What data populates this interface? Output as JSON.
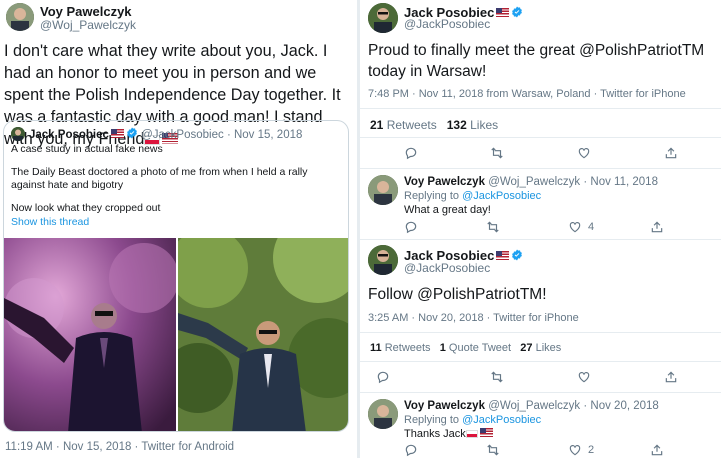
{
  "left": {
    "author": {
      "name": "Voy Pawelczyk",
      "handle": "@Woj_Pawelczyk"
    },
    "text": "I don't care what they write about you, Jack. I had an honor to meet you in person and we spent the Polish Independence Day together. It was a fantastic day with a good man! I stand with you, my Friend",
    "quote": {
      "name": "Jack Posobiec",
      "handle": "@JackPosobiec",
      "date": "· Nov 15, 2018",
      "line1": "A case study in actual fake news",
      "line2": "The Daily Beast doctored a photo of me from when I held a rally against hate and bigotry",
      "line3": "Now look what they cropped out",
      "show_thread": "Show this thread"
    },
    "timestamp": "11:19 AM · Nov 15, 2018 · Twitter for Android"
  },
  "right": {
    "tweet1": {
      "name": "Jack Posobiec",
      "handle": "@JackPosobiec",
      "text": "Proud to finally meet the great @PolishPatriotTM today in Warsaw!",
      "timestamp": "7:48 PM · Nov 11, 2018 from Warsaw, Poland · Twitter for iPhone",
      "retweets_count": "21",
      "retweets_label": "Retweets",
      "likes_count": "132",
      "likes_label": "Likes"
    },
    "reply1": {
      "name": "Voy Pawelczyk",
      "handle": "@Woj_Pawelczyk",
      "date": "· Nov 11, 2018",
      "replying_prefix": "Replying to",
      "replying_to": "@JackPosobiec",
      "text": "What a great day!",
      "likes": "4"
    },
    "tweet2": {
      "name": "Jack Posobiec",
      "handle": "@JackPosobiec",
      "text": "Follow @PolishPatriotTM!",
      "timestamp": "3:25 AM · Nov 20, 2018 · Twitter for iPhone",
      "retweets_count": "11",
      "retweets_label": "Retweets",
      "quotes_count": "1",
      "quotes_label": "Quote Tweet",
      "likes_count": "27",
      "likes_label": "Likes"
    },
    "reply2": {
      "name": "Voy Pawelczyk",
      "handle": "@Woj_Pawelczyk",
      "date": "· Nov 20, 2018",
      "replying_prefix": "Replying to",
      "replying_to": "@JackPosobiec",
      "text": "Thanks Jack",
      "likes": "2"
    }
  },
  "icons": [
    "reply-icon",
    "retweet-icon",
    "like-icon",
    "share-icon",
    "verified-badge-icon",
    "poland-flag-icon",
    "usa-flag-icon"
  ],
  "colors": {
    "link": "#1b95e0",
    "secondary": "#657786",
    "divider": "#e6ecf0",
    "verified": "#1da1f2"
  }
}
